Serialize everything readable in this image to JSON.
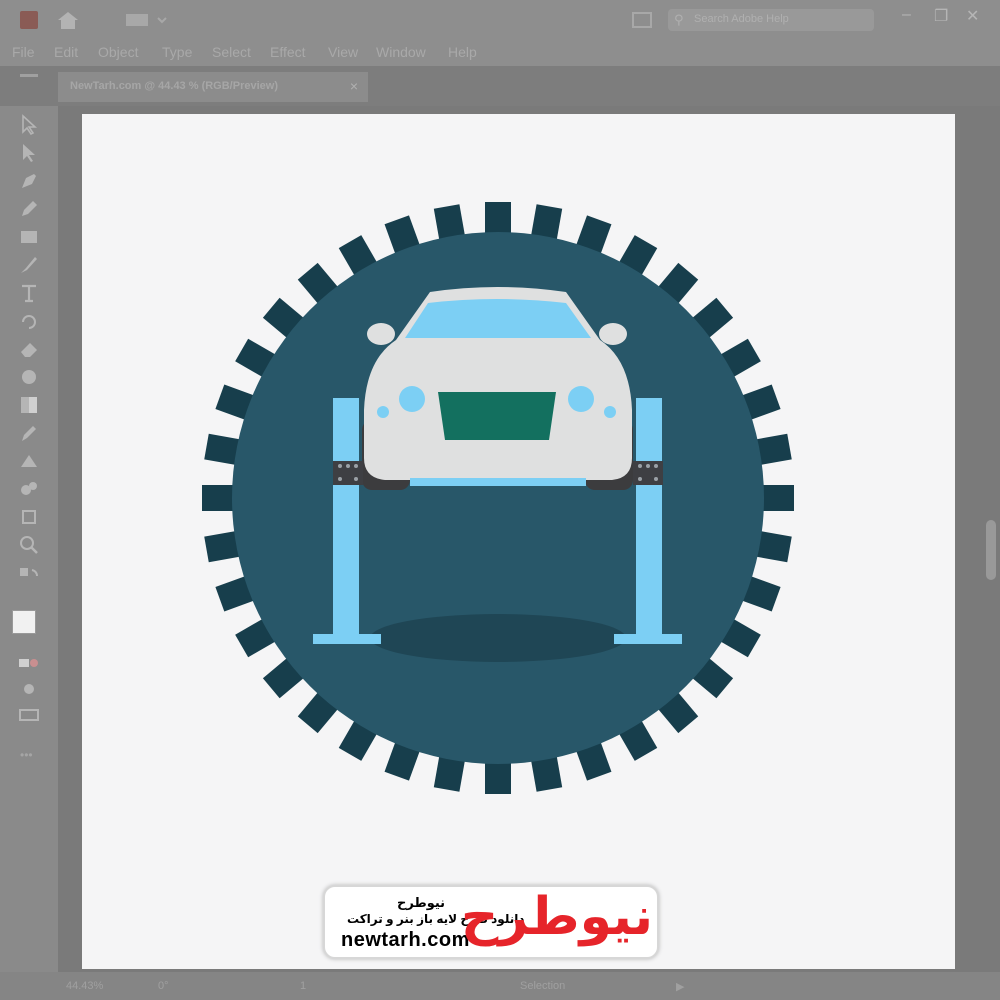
{
  "app": {
    "document_tab": "NewTarh.com @ 44.43 % (RGB/Preview)",
    "search_placeholder": "Search Adobe Help"
  },
  "menu": [
    "File",
    "Edit",
    "Object",
    "Type",
    "Select",
    "Effect",
    "View",
    "Window",
    "Help"
  ],
  "status": {
    "zoom": "44.43%",
    "rotation": "0°",
    "artboard": "1",
    "mode": "Selection"
  },
  "watermark": {
    "title": "نیوطرح",
    "subtitle": "دانلود طرح لایه باز بنر و تراکت",
    "url": "newtarh.com",
    "logo_text": "نیوطرح"
  },
  "colors": {
    "badge_circle": "#285769",
    "badge_teeth": "#173e4c",
    "car_body": "#dfe0e0",
    "windshield": "#7ccff4",
    "grille": "#13705f",
    "lift_posts": "#7ccff4",
    "tires": "#3c3c3e",
    "brand_red": "#e6242a"
  },
  "illustration": {
    "subject": "car on two-post lift",
    "tooth_count": 36
  }
}
